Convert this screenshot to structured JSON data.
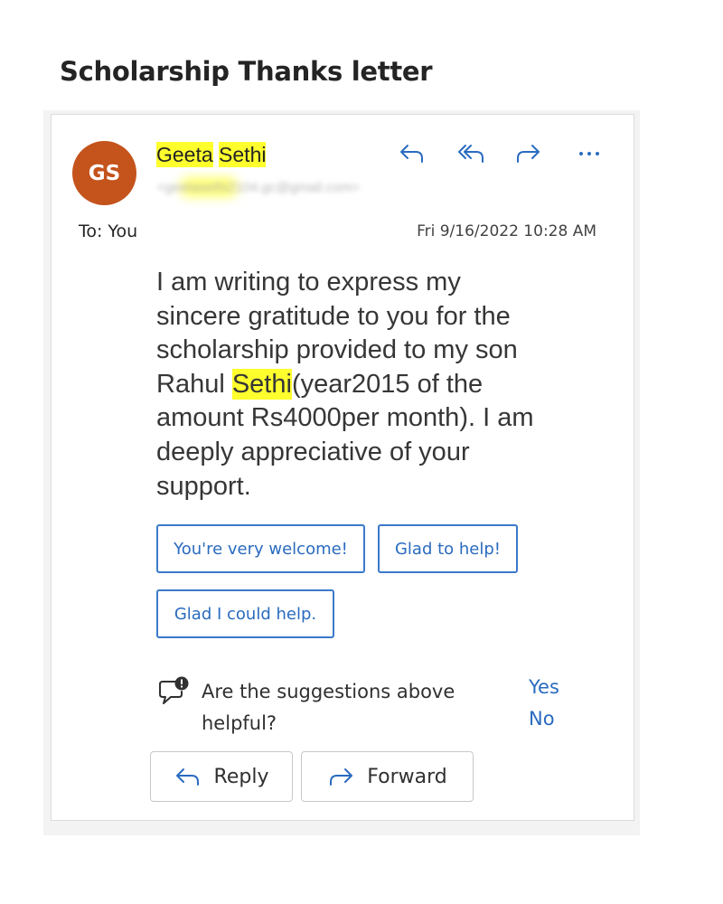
{
  "page": {
    "title": "Scholarship Thanks letter"
  },
  "message": {
    "avatar_initials": "GS",
    "sender": {
      "first": "Geeta",
      "last": "Sethi",
      "email": "<geetasethi2104.gc@gmail.com>"
    },
    "to_label": "To:",
    "to_value": "You",
    "date": "Fri 9/16/2022 10:28 AM",
    "body": {
      "part1": "I am writing to express my\nsincere gratitude to you for  the\nscholarship provided to my son\nRahul ",
      "highlight": "Sethi",
      "part2": "(year2015 of the\namount Rs4000per month).  I am\ndeeply appreciative of your\nsupport."
    }
  },
  "header_actions": [
    {
      "icon": "reply-icon"
    },
    {
      "icon": "reply-all-icon"
    },
    {
      "icon": "forward-icon"
    },
    {
      "icon": "more-icon"
    }
  ],
  "suggestions": [
    "You're very welcome!",
    "Glad to help!",
    "Glad I could help."
  ],
  "feedback": {
    "question": "Are the suggestions above helpful?",
    "yes": "Yes",
    "no": "No",
    "icon": "feedback-icon"
  },
  "buttons": {
    "reply": "Reply",
    "forward": "Forward"
  },
  "colors": {
    "avatar": "#c4531c",
    "highlight": "#ffff2e",
    "link": "#2a6bbf",
    "accent_border": "#3b79c9"
  }
}
